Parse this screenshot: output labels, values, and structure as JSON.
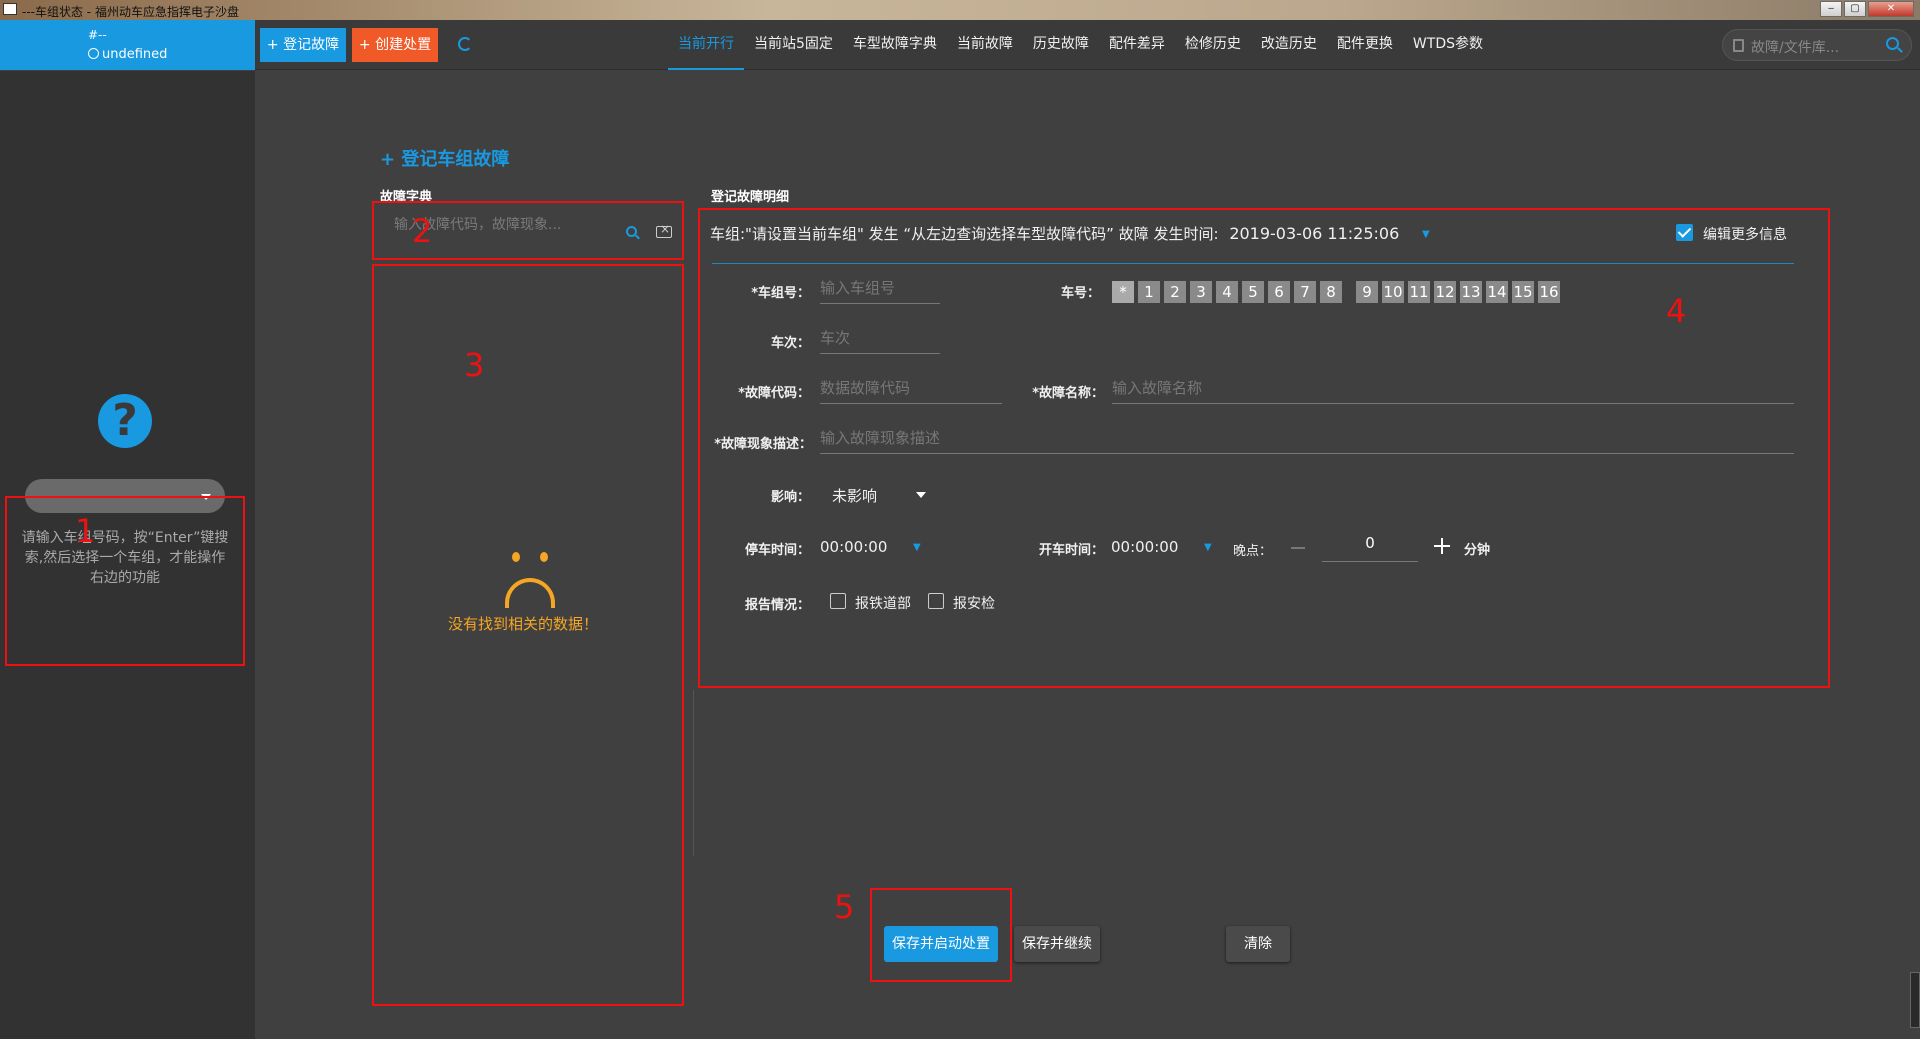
{
  "window": {
    "title": "---车组状态 - 福州动车应急指挥电子沙盘",
    "minimize": "‒",
    "maximize": "▢",
    "close": "✕"
  },
  "topnav": {
    "train_id": "#--",
    "train_status": "undefined",
    "register_button": "+ 登记故障",
    "create_button": "+ 创建处置",
    "tabs": [
      "当前开行",
      "当前站5固定",
      "车型故障字典",
      "当前故障",
      "历史故障",
      "配件差异",
      "检修历史",
      "改造历史",
      "配件更换",
      "WTDS参数"
    ],
    "active_tab": 0,
    "search_placeholder": "故障/文件库..."
  },
  "sidebar": {
    "help_icon": "question-icon",
    "hint": "请输入车组号码，按“Enter”键搜索,然后选择一个车组，才能操作右边的功能"
  },
  "main": {
    "heading": "+ 登记车组故障",
    "dict_label": "故障字典",
    "dict_search_placeholder": "输入故障代码，故障现象...",
    "no_data": "没有找到相关的数据！",
    "detail_label": "登记故障明细"
  },
  "detail": {
    "header_text": "车组:\"请设置当前车组\" 发生 “从左边查询选择车型故障代码” 故障 发生时间:",
    "time": "2019-03-06 11:25:06",
    "edit_more": "编辑更多信息",
    "train_group_label": "*车组号：",
    "train_group_placeholder": "输入车组号",
    "car_label": "车号：",
    "cars_a": [
      "*",
      "1",
      "2",
      "3",
      "4",
      "5",
      "6",
      "7",
      "8"
    ],
    "cars_b": [
      "9",
      "10",
      "11",
      "12",
      "13",
      "14",
      "15",
      "16"
    ],
    "trip_label": "车次：",
    "trip_placeholder": "车次",
    "code_label": "*故障代码：",
    "code_placeholder": "数据故障代码",
    "name_label": "*故障名称：",
    "name_placeholder": "输入故障名称",
    "desc_label": "*故障现象描述：",
    "desc_placeholder": "输入故障现象描述",
    "impact_label": "影响：",
    "impact_value": "未影响",
    "stop_label": "停车时间：",
    "stop_value": "00:00:00",
    "start_label": "开车时间：",
    "start_value": "00:00:00",
    "late_label": "晚点：",
    "late_value": "0",
    "late_unit": "分钟",
    "report_label": "报告情况：",
    "report_rail": "报铁道部",
    "report_safety": "报安检"
  },
  "actions": {
    "save_start": "保存并启动处置",
    "save_continue": "保存并继续",
    "clear": "清除"
  },
  "annotations": [
    "1",
    "2",
    "3",
    "4",
    "5"
  ],
  "colors": {
    "accent": "#1899e0",
    "danger": "#f05a28",
    "warning": "#f5a623",
    "annotation": "#e11111"
  }
}
